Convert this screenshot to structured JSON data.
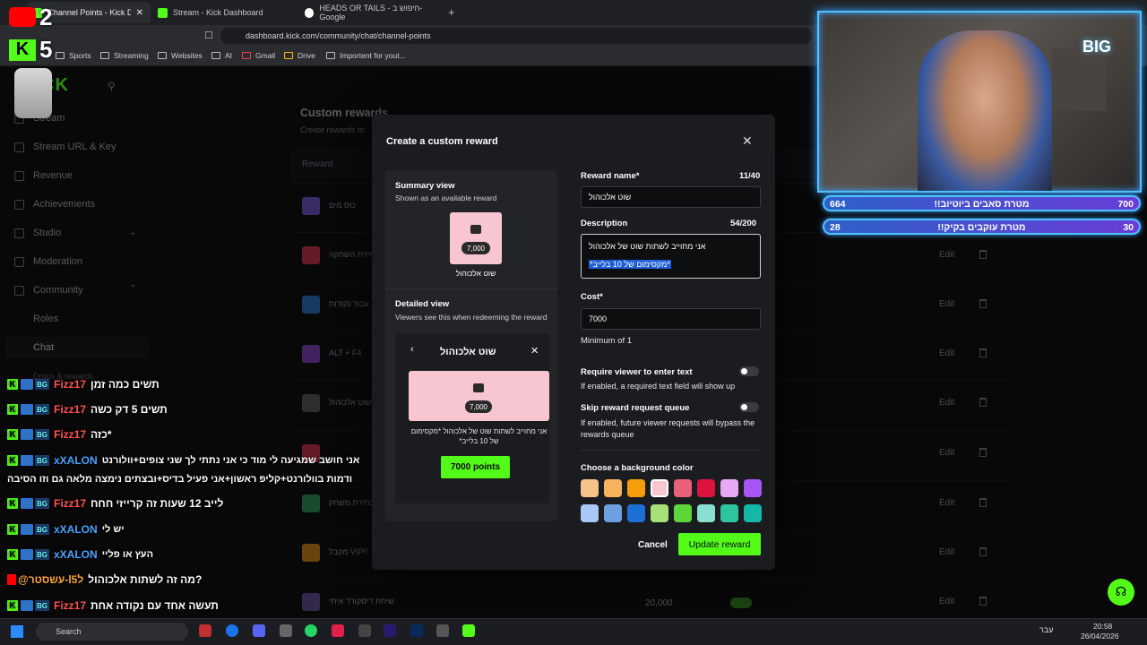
{
  "browser": {
    "tabs": [
      {
        "label": "Channel Points - Kick Dashboard"
      },
      {
        "label": "Stream - Kick Dashboard"
      },
      {
        "label": "HEADS OR TAILS - חיפוש ב-Google"
      }
    ],
    "url": "dashboard.kick.com/community/chat/channel-points",
    "bookmarks": [
      "Sports",
      "Streaming",
      "Websites",
      "AI",
      "Gmail",
      "Drive",
      "Importent for yout..."
    ]
  },
  "sidebar": {
    "items": [
      {
        "label": "Stream"
      },
      {
        "label": "Stream URL & Key"
      },
      {
        "label": "Revenue"
      },
      {
        "label": "Achievements"
      },
      {
        "label": "Studio"
      },
      {
        "label": "Moderation"
      },
      {
        "label": "Community"
      }
    ],
    "subitems": [
      "Roles",
      "Chat",
      "Drops & rewards"
    ]
  },
  "content": {
    "title": "Custom rewards",
    "subtitle": "Create rewards to",
    "column_reward": "Reward",
    "rows": [
      {
        "name": "כוס מים",
        "color": "#6b4fb8"
      },
      {
        "name": "בחירת השתקה",
        "color": "#b8324a"
      },
      {
        "name": "עבור נקודות",
        "color": "#2b6cb0"
      },
      {
        "name": "ALT + F4",
        "color": "#7a3fb0"
      },
      {
        "name": "שוט אלכוהול",
        "color": "#555"
      },
      {
        "name": "בחירת משחק",
        "color": "#2e8b57"
      },
      {
        "name": "מקבל VIP!!",
        "color": "#c47a1a"
      },
      {
        "name": "שיחת דיסקורד איתי",
        "color": "#5a4a8a",
        "cost": "20,000"
      }
    ],
    "edit_label": "Edit"
  },
  "modal": {
    "title": "Create a custom reward",
    "summary_title": "Summary view",
    "summary_sub": "Shown as an available reward",
    "card_cost": "7,000",
    "card_name": "שוט אלכוהול",
    "detailed_title": "Detailed view",
    "detailed_sub": "Viewers see this when redeeming the reward",
    "detailed_name": "שוט אלכוהול",
    "detailed_desc": "אני מחוייב לשתות שוט של אלכוהול *מקסימום של 10 בלייב*",
    "points_button": "7000 points",
    "reward_name_label": "Reward name*",
    "reward_name_counter": "11/40",
    "reward_name_value": "שוט אלכוהול",
    "description_label": "Description",
    "description_counter": "54/200",
    "description_line1": "אני מחוייב לשתות שוט של אלכוהול",
    "description_line2": "*מקסימום של 10 בלייב*",
    "cost_label": "Cost*",
    "cost_value": "7000",
    "cost_hint": "Minimum of 1",
    "require_label": "Require viewer to enter text",
    "require_hint": "If enabled, a required text field will show up",
    "skip_label": "Skip reward request queue",
    "skip_hint": "If enabled, future viewer requests will bypass the rewards queue",
    "color_label": "Choose a background color",
    "colors": [
      "#f5c48a",
      "#f5b35e",
      "#f59e0b",
      "#f7c6d0",
      "#e8607a",
      "#dc143c",
      "#e9a8f5",
      "#a855f7",
      "#a9c8f5",
      "#6e9fe0",
      "#1d6fd6",
      "#a8e07a",
      "#5ed63a",
      "#8ae0d0",
      "#2ec4a0",
      "#14b8a6"
    ],
    "cancel": "Cancel",
    "update": "Update reward"
  },
  "chat": {
    "messages": [
      {
        "user": "Fizz17",
        "text": "תשים כמה זמן",
        "style": "red"
      },
      {
        "user": "Fizz17",
        "text": "תשים 5 דק כשה",
        "style": "red"
      },
      {
        "user": "Fizz17",
        "text": "כזה*",
        "style": "red"
      },
      {
        "user": "xXALON",
        "text": "אני חושב שמגיעה לי מוד כי אני נתתי לך שני צופים+וולורנט",
        "style": "blue"
      },
      {
        "user": "",
        "text": "ודמות בוולורנט+קליפ ראשון+אני פעיל בדיס+ובצתים נימצה מלאה גם וזו הסיבה",
        "style": "none"
      },
      {
        "user": "Fizz17",
        "text": "לייב 12 שעות זה קרייזי חחח",
        "style": "red"
      },
      {
        "user": "xXALON",
        "text": "יש לי",
        "style": "blue"
      },
      {
        "user": "xXALON",
        "text": "העץ או פליי",
        "style": "blue"
      },
      {
        "user": "@עשסטר-l5ל",
        "text": "מה זה לשתות אלכוהול?",
        "style": "yt"
      },
      {
        "user": "Fizz17",
        "text": "תעשה אחד עם נקודה אחת",
        "style": "red"
      }
    ]
  },
  "overlay": {
    "score_top": "2",
    "score_bottom": "5",
    "goals": [
      {
        "left": "664",
        "text": "!!מטרת סאבים ביוטיוב",
        "right": "700"
      },
      {
        "left": "28",
        "text": "!!מטרת עוקבים בקיק",
        "right": "30"
      }
    ],
    "big_logo": "BIG"
  },
  "taskbar": {
    "search": "Search",
    "lang": "עבר",
    "time": "20:58",
    "date": "26/04/2026"
  }
}
